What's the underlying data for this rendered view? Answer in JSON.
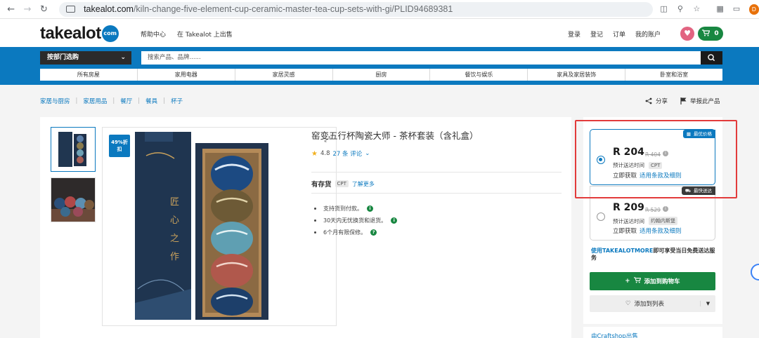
{
  "browser": {
    "host": "takealot.com",
    "path": "/kiln-change-five-element-cup-ceramic-master-tea-cup-sets-with-gi/PLID94689381",
    "profile_initial": "D"
  },
  "header": {
    "logo_word": "takealot",
    "logo_badge": "com",
    "links_left": [
      "帮助中心",
      "在 Takealot 上出售"
    ],
    "links_right": [
      "登录",
      "登记",
      "订单",
      "我的账户"
    ],
    "cart_count": "0"
  },
  "nav": {
    "dept_label": "按部门选购",
    "search_placeholder": "搜索产品、品牌......",
    "categories": [
      "所有房屋",
      "家用电器",
      "家居灵感",
      "厨房",
      "餐饮与娱乐",
      "家具及家居装饰",
      "卧室和浴室"
    ]
  },
  "breadcrumbs": [
    "家居与厨房",
    "家居用品",
    "餐厅",
    "餐具",
    "杯子"
  ],
  "actions": {
    "share": "分享",
    "report": "举报此产品"
  },
  "product": {
    "discount_badge": "49%折扣",
    "title": "窑变五行杯陶瓷大师 - 茶杯套装（含礼盒）",
    "rating": "4.8",
    "review_count": "27 条 评论",
    "stock": "有存货",
    "stock_tag": "CPT",
    "learn_more": "了解更多",
    "features": [
      "支持货到付款。",
      "30天内无忧换货和退货。",
      "6个月有限保修。"
    ],
    "box_text": "匠心之作"
  },
  "offers": [
    {
      "ribbon": "最优价格",
      "price": "R 204",
      "old_price": "R 404",
      "eta_label": "预计送达时间",
      "eta_tag": "CPT",
      "get_now": "立即获取",
      "terms": "适用条款及细则",
      "selected": true
    },
    {
      "ribbon": "最快送达",
      "price": "R 209",
      "old_price": "R 529",
      "eta_label": "预计送达时间",
      "eta_tag": "约翰内斯堡",
      "get_now": "立即获取",
      "terms": "适用条款及细则",
      "selected": false
    }
  ],
  "promo": {
    "link": "使用TAKEALOTMORE",
    "text": "即可享受当日免费送达服务"
  },
  "buttons": {
    "add_to_cart": "添加到购物车",
    "add_to_list": "添加到列表"
  },
  "seller_partial": "由Craftshop出售",
  "colors": {
    "brand_blue": "#0b79bf",
    "green": "#188741",
    "highlight_red": "#e23b3b",
    "heart_pink": "#e26481"
  }
}
